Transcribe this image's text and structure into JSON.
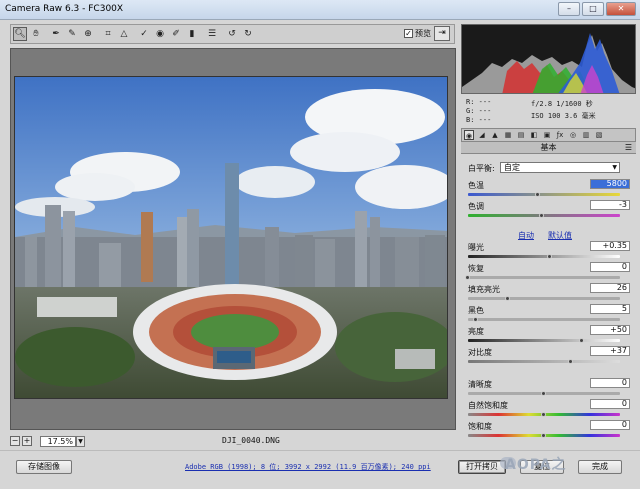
{
  "window": {
    "title": "Camera Raw 6.3 -  FC300X",
    "minimize": "–",
    "maximize": "□",
    "close": "✕"
  },
  "toolbar": {
    "tools": [
      "zoom",
      "hand",
      "white-balance",
      "color-sampler",
      "target-adjust",
      "crop",
      "straighten",
      "spot-removal",
      "red-eye",
      "adjustment-brush",
      "graduated-filter",
      "preferences",
      "rotate-ccw",
      "rotate-cw"
    ],
    "preview_label": "预览",
    "preview_checked": "✓"
  },
  "status": {
    "zoom_minus": "−",
    "zoom_plus": "+",
    "zoom_value": "17.5%",
    "filename": "DJI_0040.DNG"
  },
  "meta": {
    "r": "R:  ---",
    "g": "G:  ---",
    "b": "B:  ---",
    "exposure": "f/2.8   1/1600 秒",
    "iso": "ISO 100   3.6 毫米"
  },
  "panel": {
    "title": "基本",
    "white_balance_label": "白平衡:",
    "white_balance_value": "自定",
    "temperature_label": "色温",
    "temperature_value": "5800",
    "tint_label": "色调",
    "tint_value": "-3",
    "auto_label": "自动",
    "default_label": "默认值",
    "exposure_label": "曝光",
    "exposure_value": "+0.35",
    "recovery_label": "恢复",
    "recovery_value": "0",
    "fill_light_label": "填充亮光",
    "fill_light_value": "26",
    "blacks_label": "黑色",
    "blacks_value": "5",
    "brightness_label": "亮度",
    "brightness_value": "+50",
    "contrast_label": "对比度",
    "contrast_value": "+37",
    "clarity_label": "清晰度",
    "clarity_value": "0",
    "vibrance_label": "自然饱和度",
    "vibrance_value": "0",
    "saturation_label": "饱和度",
    "saturation_value": "0"
  },
  "sliders": {
    "temperature": 0.46,
    "tint": 0.49,
    "exposure": 0.54,
    "recovery": 0.0,
    "fill_light": 0.26,
    "blacks": 0.05,
    "brightness": 0.75,
    "contrast": 0.68,
    "clarity": 0.5,
    "vibrance": 0.5,
    "saturation": 0.5
  },
  "bottom": {
    "save_label": "存储图像",
    "workflow_link": "Adobe RGB (1998); 8 位; 3992 x 2992 (11.9 百万像素); 240 ppi",
    "open_label": "打开拷贝",
    "reset_label": "复位",
    "done_label": "完成",
    "watermark": "AOPA之"
  },
  "colors": {
    "panel_bg": "#d6d6d6",
    "canvas_bg": "#7a7a7a",
    "link": "#1a2fb0",
    "selected": "#3a6ed8"
  }
}
